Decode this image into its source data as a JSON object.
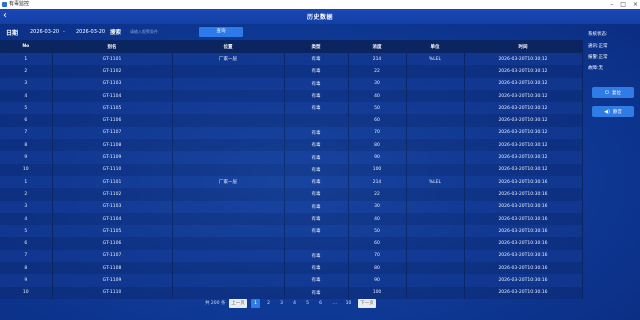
{
  "window": {
    "title": "有毒监控"
  },
  "header": {
    "title": "历史数据"
  },
  "filter": {
    "date_label": "日期",
    "start_date": "2026-03-20",
    "separator": "-",
    "end_date": "2026-03-20",
    "search_label": "搜索",
    "search_placeholder": "请输入报警条件",
    "query_label": "查询"
  },
  "table": {
    "columns": [
      "No",
      "别名",
      "位置",
      "类型",
      "浓度",
      "单位",
      "时间"
    ],
    "rows": [
      [
        "1",
        "GT-1101",
        "厂家一层",
        "有毒",
        "214",
        "%LEL",
        "2026-03-20T10:30:12"
      ],
      [
        "2",
        "GT-1102",
        "",
        "有毒",
        "22",
        "",
        "2026-03-20T10:30:12"
      ],
      [
        "3",
        "GT-1103",
        "",
        "有毒",
        "30",
        "",
        "2026-03-20T10:30:12"
      ],
      [
        "4",
        "GT-1104",
        "",
        "有毒",
        "40",
        "",
        "2026-03-20T10:30:12"
      ],
      [
        "5",
        "GT-1105",
        "",
        "有毒",
        "50",
        "",
        "2026-03-20T10:30:12"
      ],
      [
        "6",
        "GT-1106",
        "",
        "",
        "60",
        "",
        "2026-03-20T10:30:12"
      ],
      [
        "7",
        "GT-1107",
        "",
        "有毒",
        "70",
        "",
        "2026-03-20T10:30:12"
      ],
      [
        "8",
        "GT-1108",
        "",
        "有毒",
        "80",
        "",
        "2026-03-20T10:30:12"
      ],
      [
        "9",
        "GT-1109",
        "",
        "有毒",
        "90",
        "",
        "2026-03-20T10:30:12"
      ],
      [
        "10",
        "GT-1110",
        "",
        "有毒",
        "100",
        "",
        "2026-03-20T10:30:12"
      ],
      [
        "1",
        "GT-1101",
        "厂家一层",
        "有毒",
        "214",
        "%LEL",
        "2026-03-20T10:30:16"
      ],
      [
        "2",
        "GT-1102",
        "",
        "有毒",
        "22",
        "",
        "2026-03-20T10:30:16"
      ],
      [
        "3",
        "GT-1103",
        "",
        "有毒",
        "30",
        "",
        "2026-03-20T10:30:16"
      ],
      [
        "4",
        "GT-1104",
        "",
        "有毒",
        "40",
        "",
        "2026-03-20T10:30:16"
      ],
      [
        "5",
        "GT-1105",
        "",
        "有毒",
        "50",
        "",
        "2026-03-20T10:30:16"
      ],
      [
        "6",
        "GT-1106",
        "",
        "",
        "60",
        "",
        "2026-03-20T10:30:16"
      ],
      [
        "7",
        "GT-1107",
        "",
        "有毒",
        "70",
        "",
        "2026-03-20T10:30:16"
      ],
      [
        "8",
        "GT-1108",
        "",
        "有毒",
        "80",
        "",
        "2026-03-20T10:30:16"
      ],
      [
        "9",
        "GT-1109",
        "",
        "有毒",
        "90",
        "",
        "2026-03-20T10:30:16"
      ],
      [
        "10",
        "GT-1110",
        "",
        "有毒",
        "100",
        "",
        "2026-03-20T10:30:16"
      ]
    ]
  },
  "sidebar": {
    "system_status": "系统状态:",
    "comm_status": "通讯:正常",
    "alarm_status": "报警:正常",
    "fault_status": "故障:无",
    "reset_label": "复位",
    "mute_label": "静音",
    "reset_icon": "power-icon",
    "mute_icon": "speaker-icon"
  },
  "pagination": {
    "total": "共 200 条",
    "prev": "上一页",
    "pages": [
      "1",
      "2",
      "3",
      "4",
      "5",
      "6",
      "...",
      "10"
    ],
    "next": "下一页",
    "current": "1"
  },
  "colors": {
    "accent": "#2f7ce6",
    "background": "#0f3c9a",
    "header": "#0b2560"
  }
}
